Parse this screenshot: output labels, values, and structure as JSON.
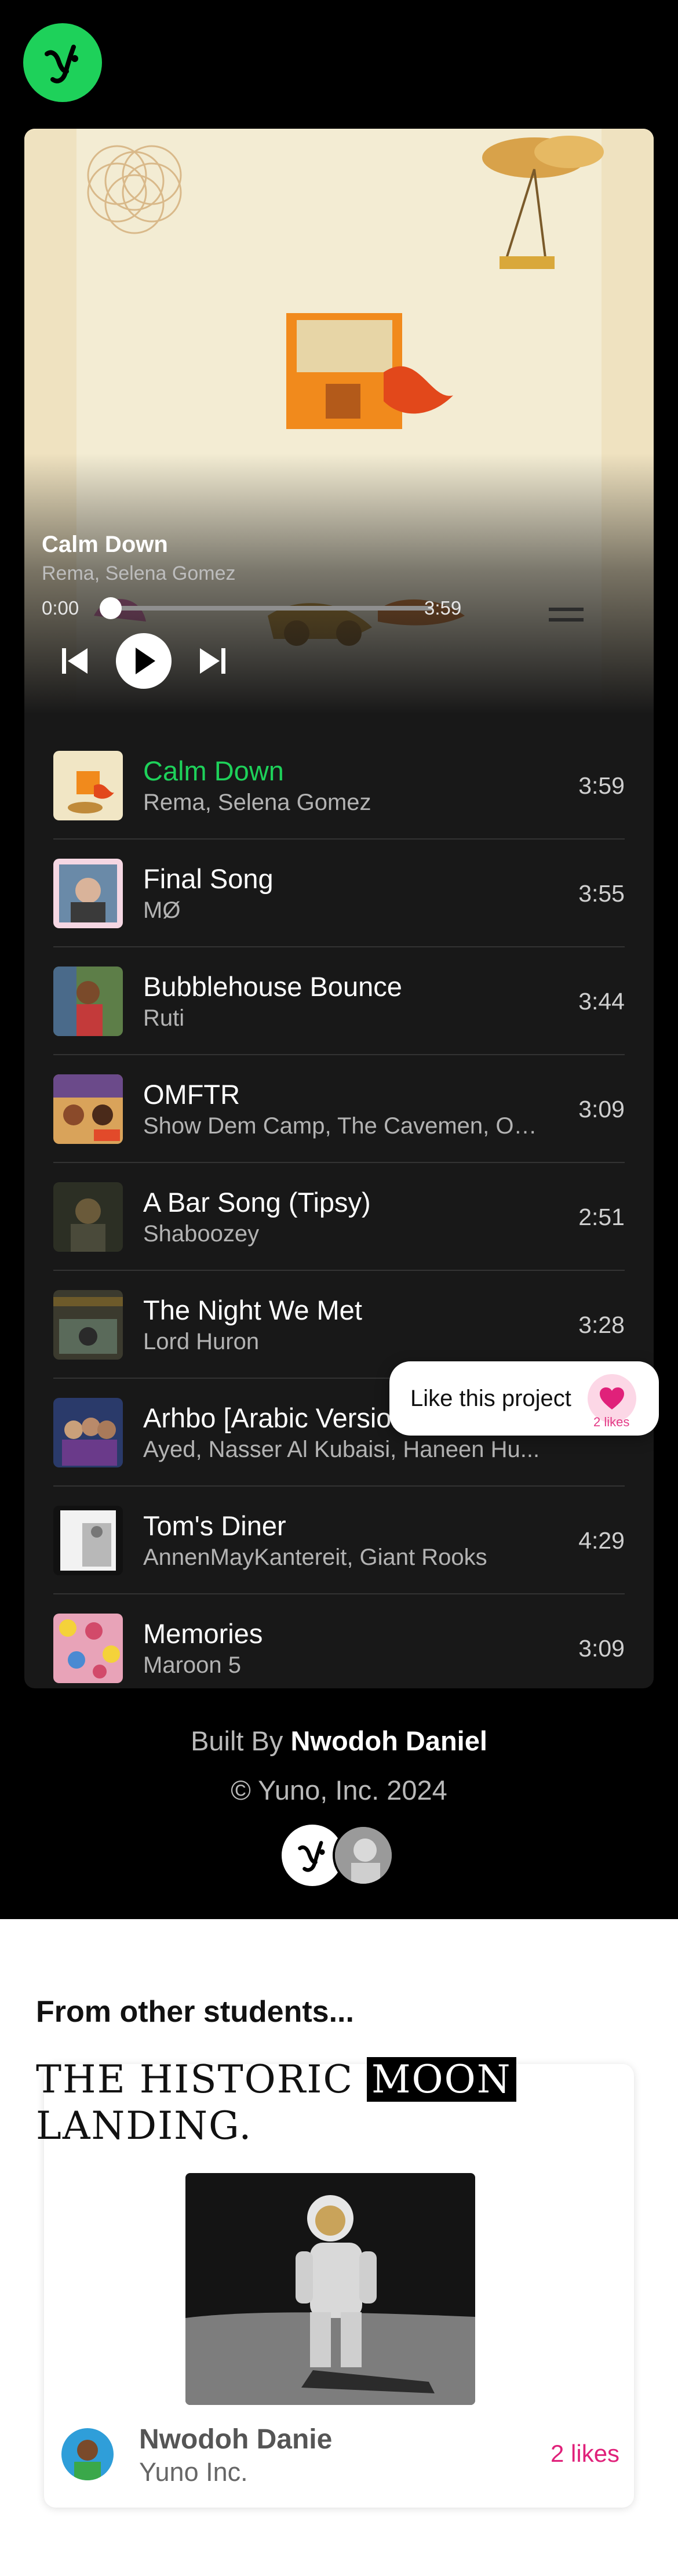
{
  "colors": {
    "accent_green": "#1ed15a",
    "background": "#000000",
    "card": "#181818",
    "like_pink": "#e0217a"
  },
  "logo_icon": "yuno-logo-icon",
  "now_playing": {
    "title": "Calm Down",
    "artist": "Rema, Selena Gomez",
    "current_time": "0:00",
    "duration": "3:59",
    "progress": 0
  },
  "controls": {
    "prev_icon": "skip-previous-icon",
    "play_icon": "play-icon",
    "next_icon": "skip-next-icon"
  },
  "playlist": [
    {
      "title": "Calm Down",
      "artist": "Rema, Selena Gomez",
      "duration": "3:59",
      "active": true
    },
    {
      "title": "Final Song",
      "artist": "MØ",
      "duration": "3:55"
    },
    {
      "title": "Bubblehouse Bounce",
      "artist": "Ruti",
      "duration": "3:44"
    },
    {
      "title": "OMFTR",
      "artist": "Show Dem Camp, The Cavemen, Ob...",
      "duration": "3:09"
    },
    {
      "title": "A Bar Song (Tipsy)",
      "artist": "Shaboozey",
      "duration": "2:51"
    },
    {
      "title": "The Night We Met",
      "artist": "Lord Huron",
      "duration": "3:28"
    },
    {
      "title": "Arhbo [Arabic Version]",
      "artist": "Ayed, Nasser Al Kubaisi, Haneen Hu...",
      "duration": ""
    },
    {
      "title": "Tom's Diner",
      "artist": "AnnenMayKantereit, Giant Rooks",
      "duration": "4:29"
    },
    {
      "title": "Memories",
      "artist": "Maroon 5",
      "duration": "3:09"
    }
  ],
  "like_prompt": {
    "label": "Like this project",
    "count": "2 likes",
    "icon": "heart-icon"
  },
  "footer": {
    "built_by_prefix": "Built By",
    "built_by_name": "Nwodoh Daniel",
    "copyright": "© Yuno, Inc. 2024"
  },
  "other_students": {
    "heading": "From other students...",
    "project": {
      "title_line1": "THE HISTORIC",
      "title_highlight": "MOON",
      "title_line2": "LANDING.",
      "author_name": "Nwodoh Danie",
      "author_org": "Yuno Inc.",
      "likes": "2 likes"
    }
  }
}
